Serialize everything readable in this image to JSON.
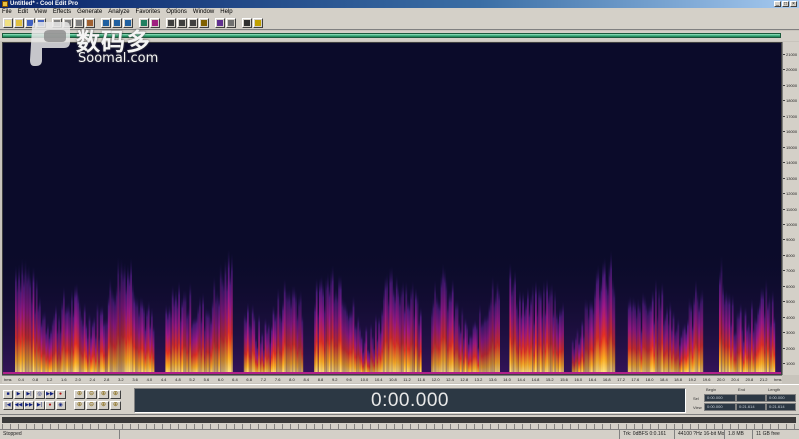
{
  "window": {
    "title": "Untitled* - Cool Edit Pro",
    "minimize_glyph": "_",
    "maximize_glyph": "□",
    "close_glyph": "×"
  },
  "menu": {
    "items": [
      "File",
      "Edit",
      "View",
      "Effects",
      "Generate",
      "Analyze",
      "Favorites",
      "Options",
      "Window",
      "Help"
    ]
  },
  "toolbar": {
    "buttons": [
      "new-icon",
      "open-icon",
      "save-icon",
      "save-all-icon",
      "cut-icon",
      "copy-icon",
      "paste-icon",
      "mix-paste-icon",
      "undo-icon",
      "redo-icon",
      "repeat-icon",
      "waveform-view-icon",
      "spectral-view-icon",
      "cursor-icon",
      "select-icon",
      "zoom-icon",
      "time-stretch-icon",
      "multitrack-icon",
      "settings-icon",
      "cd-icon",
      "help-icon"
    ]
  },
  "watermark": {
    "chinese": "数码多",
    "english": "Soomal.com"
  },
  "frequency_ruler": {
    "labels": [
      "21000",
      "20000",
      "19000",
      "18000",
      "17000",
      "16000",
      "15000",
      "14000",
      "13000",
      "12000",
      "11000",
      "10000",
      "9000",
      "8000",
      "7000",
      "6000",
      "5000",
      "4000",
      "3000",
      "2000",
      "1000"
    ]
  },
  "time_ruler": {
    "labels": [
      "hms",
      "0.4",
      "0.8",
      "1.2",
      "1.6",
      "2.0",
      "2.4",
      "2.8",
      "3.2",
      "3.6",
      "4.0",
      "4.4",
      "4.8",
      "5.2",
      "5.6",
      "6.0",
      "6.4",
      "6.8",
      "7.2",
      "7.6",
      "8.0",
      "8.4",
      "8.8",
      "9.2",
      "9.6",
      "10.0",
      "10.4",
      "10.8",
      "11.2",
      "11.6",
      "12.0",
      "12.4",
      "12.8",
      "13.2",
      "13.6",
      "14.0",
      "14.4",
      "14.8",
      "15.2",
      "15.6",
      "16.0",
      "16.4",
      "16.8",
      "17.2",
      "17.6",
      "18.0",
      "18.4",
      "18.8",
      "19.2",
      "19.6",
      "20.0",
      "20.4",
      "20.8",
      "21.2",
      "hms"
    ]
  },
  "transport": {
    "row1": [
      "■",
      "▶",
      "▶|",
      "◎",
      "▶▶",
      "●"
    ],
    "row2": [
      "|◀",
      "◀◀",
      "▶▶",
      "▶|",
      "●",
      "◉"
    ]
  },
  "zoom": {
    "row1": [
      "⊕",
      "⊖",
      "⊕",
      "⊕"
    ],
    "row2": [
      "⊕",
      "⊖",
      "⊕",
      "⊕"
    ]
  },
  "time_display": "0:00.000",
  "selection_panel": {
    "headers": [
      "Begin",
      "End",
      "Length"
    ],
    "rows": [
      {
        "label": "Sel",
        "begin": "0:00.000",
        "end": "",
        "length": "0:00.000"
      },
      {
        "label": "View",
        "begin": "0:00.000",
        "end": "0:21.614",
        "length": "0:21.614"
      }
    ]
  },
  "status": {
    "state": "Stopped",
    "cells": [
      "",
      "Trk: 0dBFS  0:0.161",
      "44100 ?Hz 16-bit Mono",
      "1.8 MB",
      "11 GB free"
    ]
  }
}
